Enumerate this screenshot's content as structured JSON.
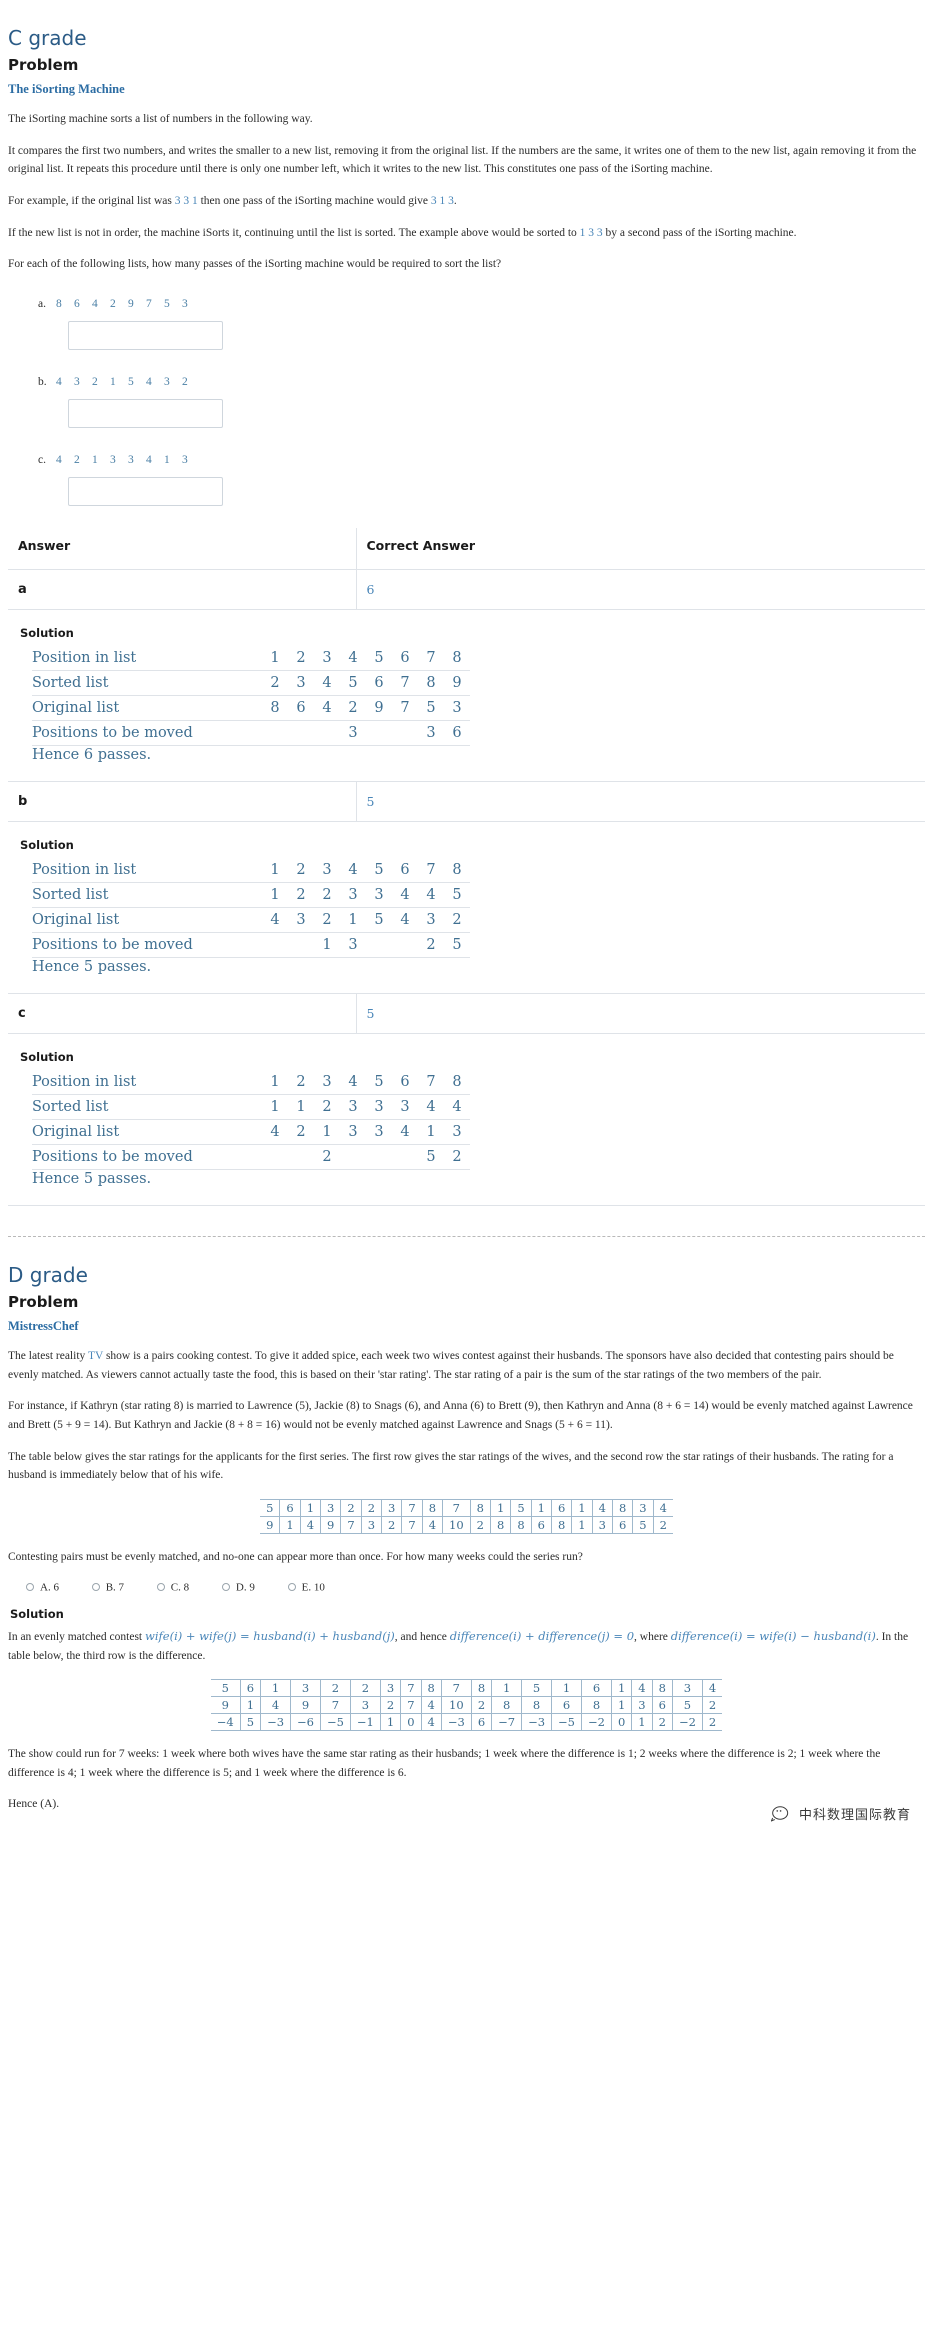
{
  "sections": [
    {
      "grade": "C grade",
      "problem_heading": "Problem",
      "problem_title": "The iSorting Machine",
      "paragraphs": [
        "The iSorting machine sorts a list of numbers in the following way.",
        "It compares the first two numbers, and writes the smaller to a new list, removing it from the original list. If the numbers are the same, it writes one of them to the new list, again removing it from the original list. It repeats this procedure until there is only one number left, which it writes to the new list. This constitutes one pass of the iSorting machine.",
        "For each of the following lists, how many passes of the iSorting machine would be required to sort the list?"
      ],
      "example_para": {
        "pre": "For example, if the original list was ",
        "list1": "3 3 1",
        "mid": " then one pass of the iSorting machine would give ",
        "list2": "3 1 3",
        "post": "."
      },
      "order_para": {
        "pre": "If the new list is not in order, the machine iSorts it, continuing until the list is sorted. The example above would be sorted to ",
        "list": "1 3 3",
        "post": " by a second pass of the iSorting machine."
      },
      "questions": [
        {
          "label": "a.",
          "numbers": [
            "8",
            "6",
            "4",
            "2",
            "9",
            "7",
            "5",
            "3"
          ],
          "input_value": "",
          "input_placeholder": ""
        },
        {
          "label": "b.",
          "numbers": [
            "4",
            "3",
            "2",
            "1",
            "5",
            "4",
            "3",
            "2"
          ],
          "input_value": "",
          "input_placeholder": ""
        },
        {
          "label": "c.",
          "numbers": [
            "4",
            "2",
            "1",
            "3",
            "3",
            "4",
            "1",
            "3"
          ],
          "input_value": "",
          "input_placeholder": ""
        }
      ],
      "table_headers": [
        "Answer",
        "Correct Answer"
      ],
      "solution_heading": "Solution",
      "rows": [
        {
          "key": "a",
          "correct": "6",
          "sol_rows": [
            {
              "label": "Position in list",
              "cells": [
                "1",
                "2",
                "3",
                "4",
                "5",
                "6",
                "7",
                "8"
              ]
            },
            {
              "label": "Sorted list",
              "cells": [
                "2",
                "3",
                "4",
                "5",
                "6",
                "7",
                "8",
                "9"
              ]
            },
            {
              "label": "Original list",
              "cells": [
                "8",
                "6",
                "4",
                "2",
                "9",
                "7",
                "5",
                "3"
              ]
            },
            {
              "label": "Positions to be moved",
              "cells": [
                "",
                "",
                "",
                "3",
                "",
                "",
                "3",
                "6"
              ]
            }
          ],
          "hence": "Hence 6 passes."
        },
        {
          "key": "b",
          "correct": "5",
          "sol_rows": [
            {
              "label": "Position in list",
              "cells": [
                "1",
                "2",
                "3",
                "4",
                "5",
                "6",
                "7",
                "8"
              ]
            },
            {
              "label": "Sorted list",
              "cells": [
                "1",
                "2",
                "2",
                "3",
                "3",
                "4",
                "4",
                "5"
              ]
            },
            {
              "label": "Original list",
              "cells": [
                "4",
                "3",
                "2",
                "1",
                "5",
                "4",
                "3",
                "2"
              ]
            },
            {
              "label": "Positions to be moved",
              "cells": [
                "",
                "",
                "1",
                "3",
                "",
                "",
                "2",
                "5"
              ]
            }
          ],
          "hence": "Hence 5 passes."
        },
        {
          "key": "c",
          "correct": "5",
          "sol_rows": [
            {
              "label": "Position in list",
              "cells": [
                "1",
                "2",
                "3",
                "4",
                "5",
                "6",
                "7",
                "8"
              ]
            },
            {
              "label": "Sorted list",
              "cells": [
                "1",
                "1",
                "2",
                "3",
                "3",
                "3",
                "4",
                "4"
              ]
            },
            {
              "label": "Original list",
              "cells": [
                "4",
                "2",
                "1",
                "3",
                "3",
                "4",
                "1",
                "3"
              ]
            },
            {
              "label": "Positions to be moved",
              "cells": [
                "",
                "",
                "2",
                "",
                "",
                "",
                "5",
                "2"
              ]
            }
          ],
          "hence": "Hence 5 passes."
        }
      ]
    }
  ],
  "d_section": {
    "grade": "D grade",
    "problem_heading": "Problem",
    "problem_title": "MistressChef",
    "para1_a": "The latest reality ",
    "para1_tv": "TV",
    "para1_b": " show is a pairs cooking contest. To give it added spice, each week two wives contest against their husbands. The sponsors have also decided that contesting pairs should be evenly matched. As viewers cannot actually taste the food, this is based on their 'star rating'. The star rating of a pair is the sum of the star ratings of the two members of the pair.",
    "para2": "For instance, if Kathryn (star rating 8) is married to Lawrence (5), Jackie (8) to Snags (6), and Anna (6) to Brett (9), then Kathryn and Anna (8 + 6 = 14) would be evenly matched against Lawrence and Brett (5 + 9 = 14). But Kathryn and Jackie (8 + 8 = 16) would not be evenly matched against Lawrence and Snags (5 + 6 = 11).",
    "para3": "The table below gives the star ratings for the applicants for the first series. The first row gives the star ratings of the wives, and the second row the star ratings of their husbands. The rating for a husband is immediately below that of his wife.",
    "question": "Contesting pairs must be evenly matched, and no-one can appear more than once. For how many weeks could the series run?",
    "choices": [
      {
        "letter": "A.",
        "value": "6"
      },
      {
        "letter": "B.",
        "value": "7"
      },
      {
        "letter": "C.",
        "value": "8"
      },
      {
        "letter": "D.",
        "value": "9"
      },
      {
        "letter": "E.",
        "value": "10"
      }
    ],
    "solution_heading": "Solution",
    "sol_para_pre": "In an evenly matched contest ",
    "sol_formula1": "wife(i) + wife(j) = husband(i) + husband(j)",
    "sol_para_mid": ", and hence ",
    "sol_formula2": "difference(i) + difference(j) = 0",
    "sol_para_mid2": ", where ",
    "sol_formula3": "difference(i) = wife(i) − husband(i)",
    "sol_para_post": ". In the table below, the third row is the difference.",
    "wives": [
      "5",
      "6",
      "1",
      "3",
      "2",
      "2",
      "3",
      "7",
      "8",
      "7",
      "8",
      "1",
      "5",
      "1",
      "6",
      "1",
      "4",
      "8",
      "3",
      "4"
    ],
    "husbands": [
      "9",
      "1",
      "4",
      "9",
      "7",
      "3",
      "2",
      "7",
      "4",
      "10",
      "2",
      "8",
      "8",
      "6",
      "8",
      "1",
      "3",
      "6",
      "5",
      "2"
    ],
    "differences": [
      "−4",
      "5",
      "−3",
      "−6",
      "−5",
      "−1",
      "1",
      "0",
      "4",
      "−3",
      "6",
      "−7",
      "−3",
      "−5",
      "−2",
      "0",
      "1",
      "2",
      "−2",
      "2"
    ],
    "final_para": "The show could run for 7 weeks: 1 week where both wives have the same star rating as their husbands; 1 week where the difference is 1; 2 weeks where the difference is 2; 1 week where the difference is 4; 1 week where the difference is 5; and 1 week where the difference is 6.",
    "hence": "Hence (A)."
  },
  "watermark": {
    "text": "中科数理国际教育"
  },
  "colors": {
    "heading_blue": "#2b5b86",
    "link_blue": "#2b6ca3",
    "math_blue": "#4a86b8",
    "rule": "#dfe3e8"
  }
}
